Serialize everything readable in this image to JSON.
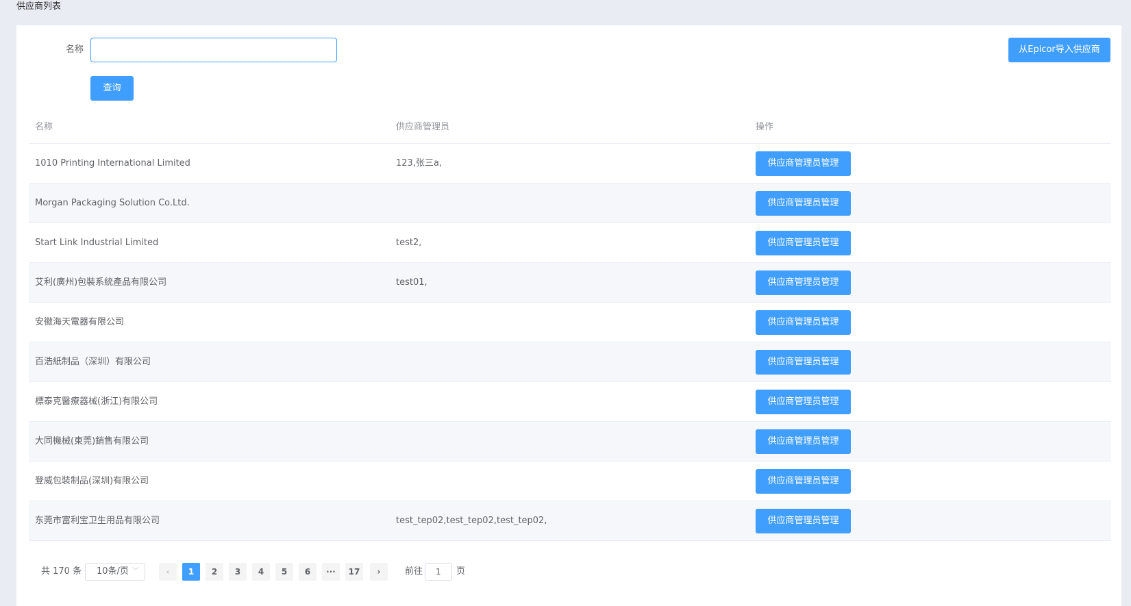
{
  "page": {
    "title": "供应商列表"
  },
  "search": {
    "label": "名称",
    "value": "",
    "query_label": "查询"
  },
  "toolbar": {
    "import_label": "从Epicor导入供应商"
  },
  "table": {
    "columns": [
      "名称",
      "供应商管理员",
      "操作"
    ],
    "action_label": "供应商管理员管理",
    "rows": [
      {
        "name": "1010 Printing International Limited",
        "admins": "123,张三a,"
      },
      {
        "name": "Morgan Packaging Solution Co.Ltd.",
        "admins": ""
      },
      {
        "name": "Start Link Industrial Limited",
        "admins": "test2,"
      },
      {
        "name": "艾利(廣州)包裝系統產品有限公司",
        "admins": "test01,"
      },
      {
        "name": "安徽海天電器有限公司",
        "admins": ""
      },
      {
        "name": "百浩紙制品（深圳）有限公司",
        "admins": ""
      },
      {
        "name": "標泰克醫療器械(浙江)有限公司",
        "admins": ""
      },
      {
        "name": "大同機械(東莞)銷售有限公司",
        "admins": ""
      },
      {
        "name": "登威包裝制品(深圳)有限公司",
        "admins": ""
      },
      {
        "name": "东莞市富利宝卫生用品有限公司",
        "admins": "test_tep02,test_tep02,test_tep02,"
      }
    ]
  },
  "pagination": {
    "total_text": "共 170 条",
    "page_size": "10条/页",
    "pages": [
      "1",
      "2",
      "3",
      "4",
      "5",
      "6",
      "···",
      "17"
    ],
    "current": "1",
    "prev": "‹",
    "next": "›",
    "goto_label": "前往",
    "goto_value": "1",
    "goto_suffix": "页"
  },
  "colors": {
    "primary": "#409eff",
    "background": "#e9ecf3",
    "stripe": "#f5f7fa"
  }
}
